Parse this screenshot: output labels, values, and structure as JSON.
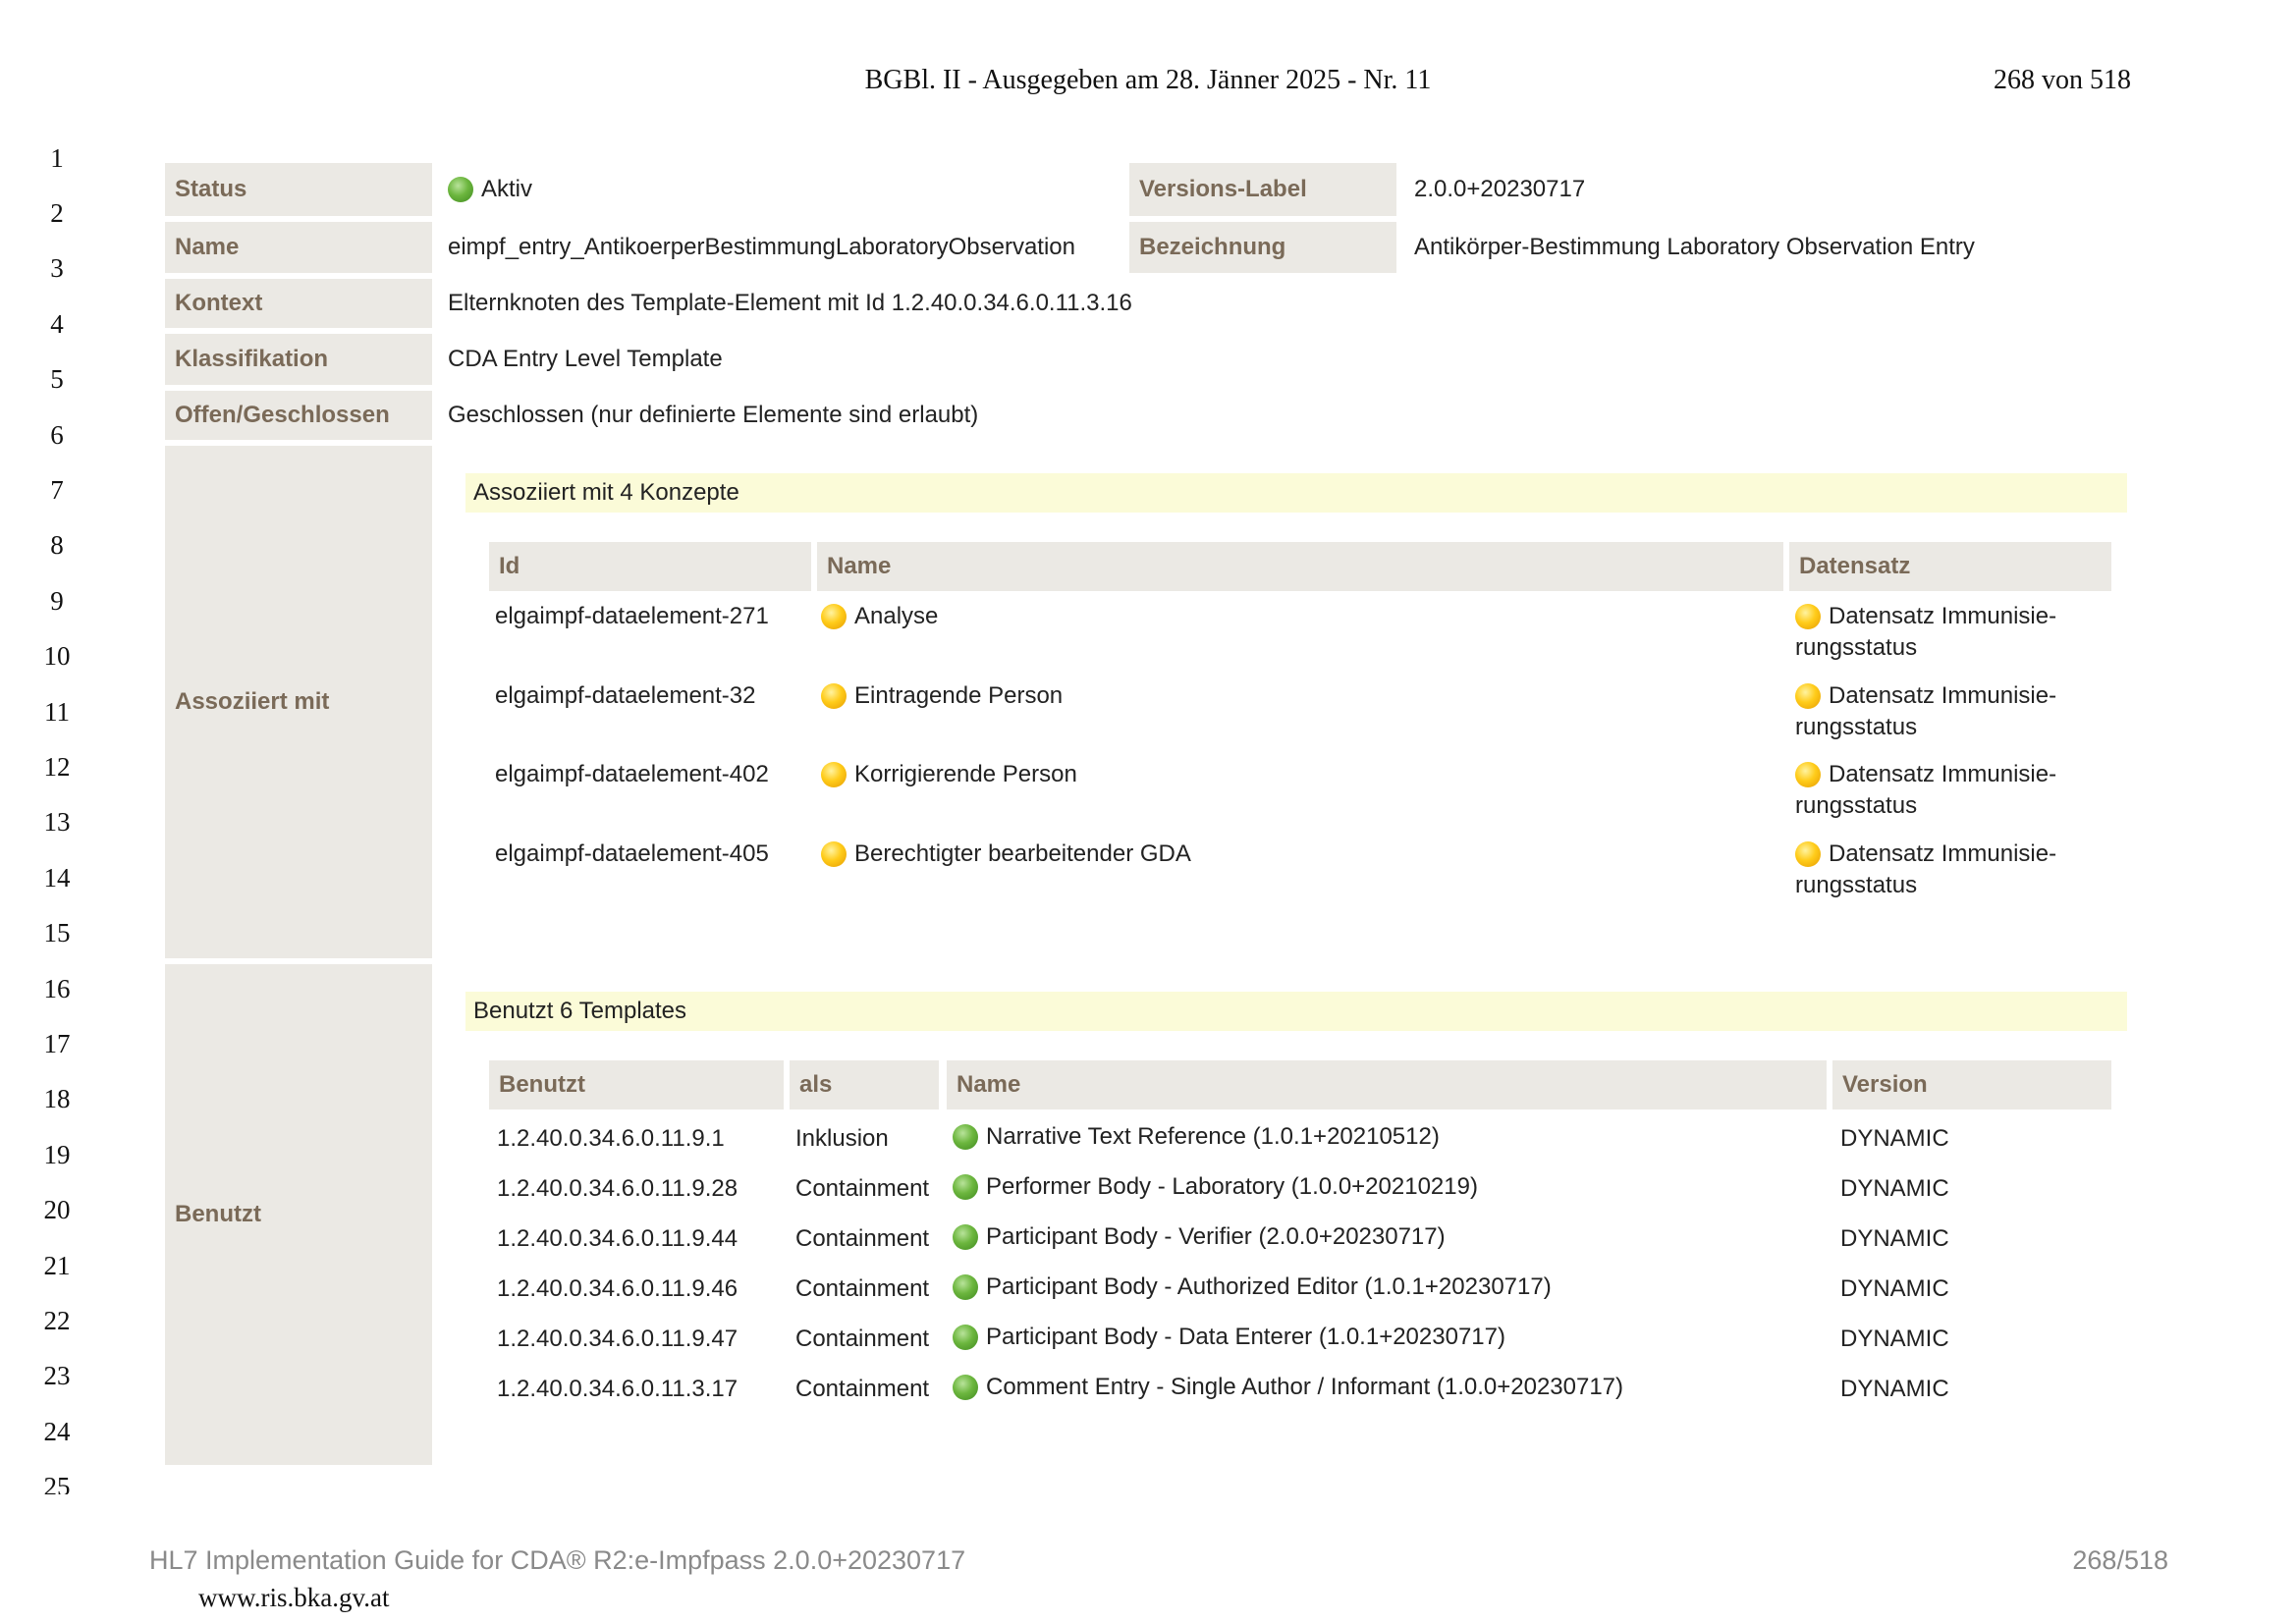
{
  "header": {
    "center": "BGBl. II - Ausgegeben am 28. Jänner 2025 - Nr. 11",
    "right": "268 von 518"
  },
  "line_numbers": [
    "1",
    "2",
    "3",
    "4",
    "5",
    "6",
    "7",
    "8",
    "9",
    "10",
    "11",
    "12",
    "13",
    "14",
    "15",
    "16",
    "17",
    "18",
    "19",
    "20",
    "21",
    "22",
    "23",
    "24",
    "25"
  ],
  "meta": {
    "status": {
      "label": "Status",
      "value": "Aktiv",
      "icon": "green-status-dot"
    },
    "versions_label": {
      "label": "Versions-Label",
      "value": "2.0.0+20230717"
    },
    "name": {
      "label": "Name",
      "value": "eimpf_entry_AntikoerperBestimmungLaboratoryObservation"
    },
    "bezeichnung": {
      "label": "Bezeichnung",
      "value": "Antikörper-Bestimmung Laboratory Observation Entry"
    },
    "kontext": {
      "label": "Kontext",
      "value": "Elternknoten des Template-Element mit Id 1.2.40.0.34.6.0.11.3.16"
    },
    "klassifikation": {
      "label": "Klassifikation",
      "value": "CDA Entry Level Template"
    },
    "offen": {
      "label": "Offen/Geschlossen",
      "value": "Geschlossen (nur definierte Elemente sind erlaubt)"
    }
  },
  "assoziiert": {
    "label": "Assoziiert mit",
    "band": "Assoziiert mit 4 Konzepte",
    "columns": [
      "Id",
      "Name",
      "Datensatz"
    ],
    "rows": [
      {
        "id": "elgaimpf-dataelement-271",
        "name": "Analyse",
        "datensatz_1": "Datensatz Immunisie-",
        "datensatz_2": "rungsstatus"
      },
      {
        "id": "elgaimpf-dataelement-32",
        "name": "Eintragende Person",
        "datensatz_1": "Datensatz Immunisie-",
        "datensatz_2": "rungsstatus"
      },
      {
        "id": "elgaimpf-dataelement-402",
        "name": "Korrigierende Person",
        "datensatz_1": "Datensatz Immunisie-",
        "datensatz_2": "rungsstatus"
      },
      {
        "id": "elgaimpf-dataelement-405",
        "name": "Berechtigter bearbeitender GDA",
        "datensatz_1": "Datensatz Immunisie-",
        "datensatz_2": "rungsstatus"
      }
    ]
  },
  "benutzt": {
    "label": "Benutzt",
    "band": "Benutzt 6 Templates",
    "columns": [
      "Benutzt",
      "als",
      "Name",
      "Version"
    ],
    "rows": [
      {
        "id": "1.2.40.0.34.6.0.11.9.1",
        "als": "Inklusion",
        "name": "Narrative Text Reference (1.0.1+20210512)",
        "version": "DYNAMIC"
      },
      {
        "id": "1.2.40.0.34.6.0.11.9.28",
        "als": "Containment",
        "name": "Performer Body - Laboratory (1.0.0+20210219)",
        "version": "DYNAMIC"
      },
      {
        "id": "1.2.40.0.34.6.0.11.9.44",
        "als": "Containment",
        "name": "Participant Body - Verifier (2.0.0+20230717)",
        "version": "DYNAMIC"
      },
      {
        "id": "1.2.40.0.34.6.0.11.9.46",
        "als": "Containment",
        "name": "Participant Body - Authorized Editor (1.0.1+20230717)",
        "version": "DYNAMIC"
      },
      {
        "id": "1.2.40.0.34.6.0.11.9.47",
        "als": "Containment",
        "name": "Participant Body - Data Enterer (1.0.1+20230717)",
        "version": "DYNAMIC"
      },
      {
        "id": "1.2.40.0.34.6.0.11.3.17",
        "als": "Containment",
        "name": "Comment Entry - Single Author / Informant (1.0.0+20230717)",
        "version": "DYNAMIC"
      }
    ]
  },
  "footer": {
    "left": "HL7 Implementation Guide for CDA® R2:e-Impfpass 2.0.0+20230717",
    "right": "268/518",
    "url": "www.ris.bka.gv.at"
  },
  "colors": {
    "label_bg": "#ebe9e4",
    "label_text": "#7a6a58",
    "band_bg": "#fbfbd8",
    "active_green": "#6cb63e",
    "concept_yellow": "#ffcc1a"
  }
}
